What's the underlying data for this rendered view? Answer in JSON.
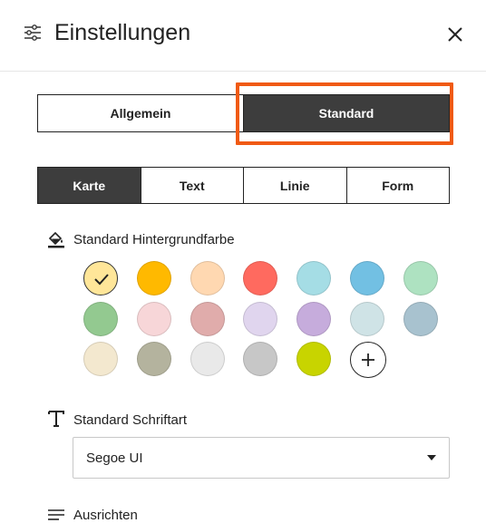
{
  "header": {
    "title": "Einstellungen",
    "settings_icon": "sliders-icon",
    "close_icon": "close-icon"
  },
  "main_tabs": [
    {
      "label": "Allgemein",
      "active": false
    },
    {
      "label": "Standard",
      "active": true
    }
  ],
  "highlight_color": "#f05a14",
  "sub_tabs": [
    {
      "label": "Karte",
      "active": true
    },
    {
      "label": "Text",
      "active": false
    },
    {
      "label": "Linie",
      "active": false
    },
    {
      "label": "Form",
      "active": false
    }
  ],
  "background_section": {
    "label": "Standard Hintergrundfarbe",
    "icon": "paint-bucket-icon",
    "selected_index": 0,
    "colors": [
      "#ffe699",
      "#ffb900",
      "#ffd8b1",
      "#ff6a5f",
      "#a5dde5",
      "#72c0e3",
      "#aee2c1",
      "#93c990",
      "#f7d6d8",
      "#e0acab",
      "#e0d5ee",
      "#c6acdc",
      "#cfe3e6",
      "#a8c2cf",
      "#f3e8cf",
      "#b4b39e",
      "#e9e9e9",
      "#c7c7c7",
      "#c8d400"
    ],
    "add_icon": "plus-icon"
  },
  "font_section": {
    "label": "Standard Schriftart",
    "icon": "text-t-icon",
    "value": "Segoe UI"
  },
  "align_section": {
    "label": "Ausrichten",
    "icon": "align-lines-icon"
  }
}
